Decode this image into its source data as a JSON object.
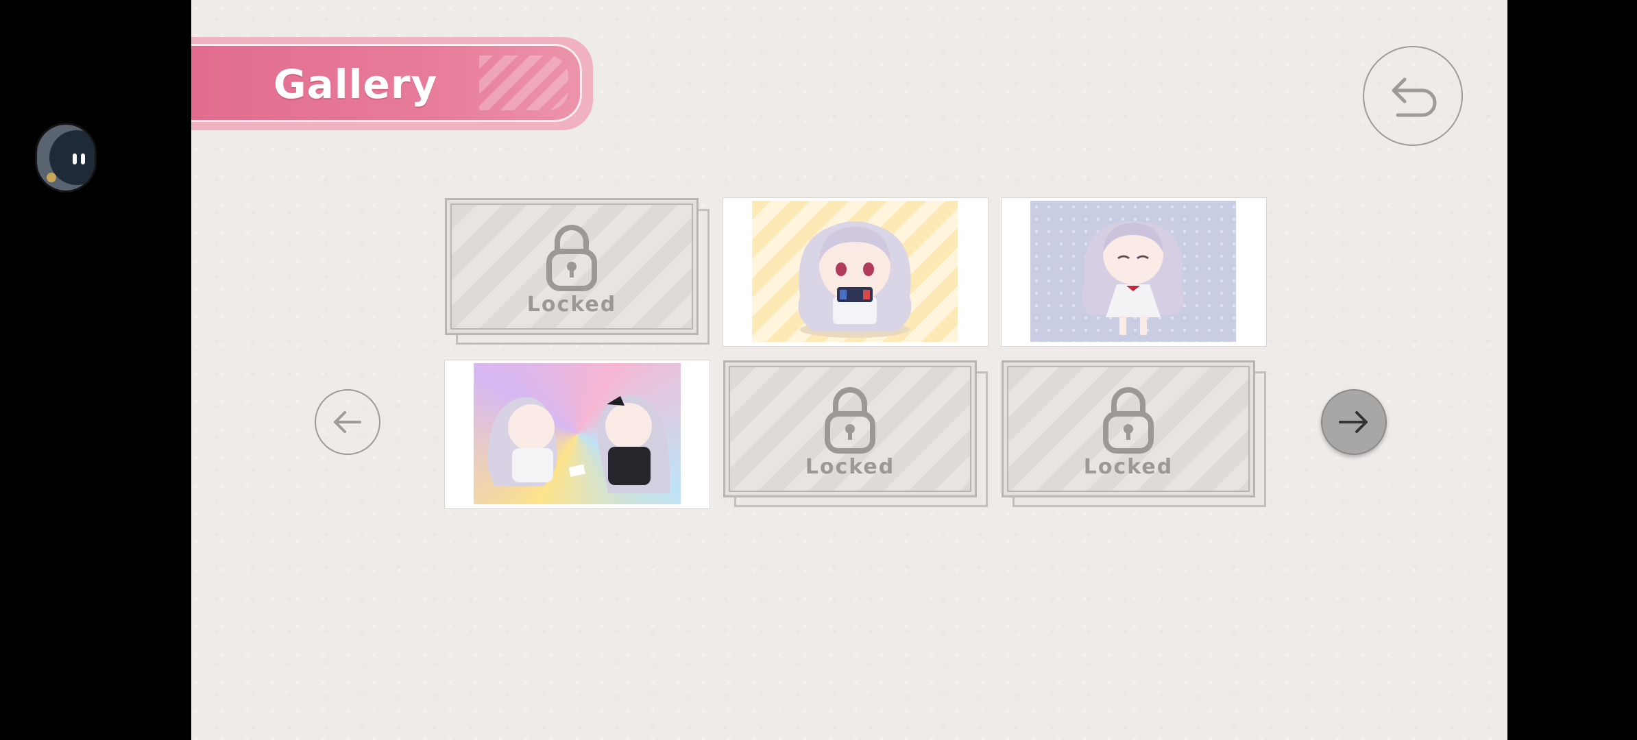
{
  "title": "Gallery",
  "icons": {
    "back": "undo-arrow-icon",
    "prev": "arrow-left-icon",
    "next": "arrow-right-icon",
    "lock": "padlock-icon",
    "assistant": "floating-assistant-icon"
  },
  "colors": {
    "background": "#eeebe9",
    "banner": "#e26c8f",
    "outline": "#9d9a98"
  },
  "gallery": {
    "items": [
      {
        "status": "locked",
        "label": "Locked"
      },
      {
        "status": "unlocked",
        "label": ""
      },
      {
        "status": "unlocked",
        "label": ""
      },
      {
        "status": "unlocked",
        "label": ""
      },
      {
        "status": "locked",
        "label": "Locked"
      },
      {
        "status": "locked",
        "label": "Locked"
      }
    ]
  }
}
